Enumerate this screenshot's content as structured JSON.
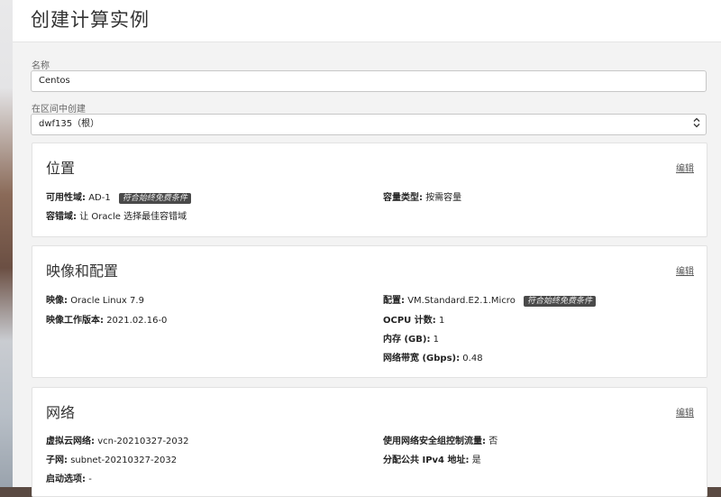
{
  "page": {
    "title": "创建计算实例"
  },
  "name_field": {
    "label": "名称",
    "value": "Centos"
  },
  "compartment_field": {
    "label": "在区间中创建",
    "value": "dwf135（根）",
    "arrow": "⌃⌄"
  },
  "sections": {
    "placement": {
      "title": "位置",
      "edit": "编辑",
      "availability_domain": {
        "key": "可用性域:",
        "value": "AD-1",
        "badge": "符合始终免费条件"
      },
      "fault_domain": {
        "key": "容错域:",
        "value": "让 Oracle 选择最佳容错域"
      },
      "capacity_type": {
        "key": "容量类型:",
        "value": "按需容量"
      }
    },
    "image_shape": {
      "title": "映像和配置",
      "edit": "编辑",
      "image": {
        "key": "映像:",
        "value": "Oracle Linux 7.9"
      },
      "image_build": {
        "key": "映像工作版本:",
        "value": "2021.02.16-0"
      },
      "shape": {
        "key": "配置:",
        "value": "VM.Standard.E2.1.Micro",
        "badge": "符合始终免费条件"
      },
      "ocpu": {
        "key": "OCPU 计数:",
        "value": "1"
      },
      "memory": {
        "key": "内存 (GB):",
        "value": "1"
      },
      "bandwidth": {
        "key": "网络带宽 (Gbps):",
        "value": "0.48"
      }
    },
    "network": {
      "title": "网络",
      "edit": "编辑",
      "vcn": {
        "key": "虚拟云网络:",
        "value": "vcn-20210327-2032"
      },
      "subnet": {
        "key": "子网:",
        "value": "subnet-20210327-2032"
      },
      "launch_options": {
        "key": "启动选项:",
        "value": "-"
      },
      "nsg": {
        "key": "使用网络安全组控制流量:",
        "value": "否"
      },
      "public_ip": {
        "key": "分配公共 IPv4 地址:",
        "value": "是"
      }
    }
  }
}
